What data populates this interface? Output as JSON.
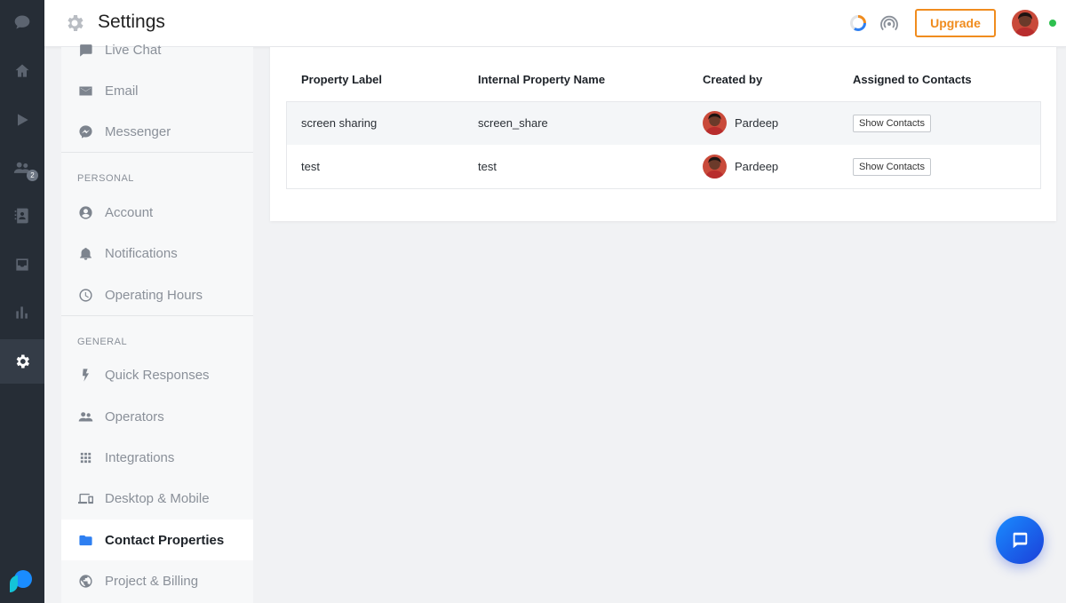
{
  "header": {
    "title": "Settings",
    "upgrade_label": "Upgrade",
    "online_color": "#2ec04f"
  },
  "rail": {
    "items": [
      {
        "name": "chat-icon"
      },
      {
        "name": "home-icon"
      },
      {
        "name": "play-icon"
      },
      {
        "name": "contacts-icon",
        "badge": "2"
      },
      {
        "name": "address-book-icon"
      },
      {
        "name": "inbox-icon"
      },
      {
        "name": "reports-icon"
      },
      {
        "name": "settings-icon",
        "active": true
      }
    ]
  },
  "sidebar": {
    "items": [
      {
        "label": "Live Chat",
        "icon": "chat-bubble-icon"
      },
      {
        "label": "Email",
        "icon": "envelope-icon"
      },
      {
        "label": "Messenger",
        "icon": "messenger-icon"
      },
      {
        "label": "Account",
        "icon": "account-icon"
      },
      {
        "label": "Notifications",
        "icon": "bell-icon"
      },
      {
        "label": "Operating Hours",
        "icon": "clock-icon"
      },
      {
        "label": "Quick Responses",
        "icon": "lightning-icon"
      },
      {
        "label": "Operators",
        "icon": "people-icon"
      },
      {
        "label": "Integrations",
        "icon": "grid-icon"
      },
      {
        "label": "Desktop & Mobile",
        "icon": "devices-icon"
      },
      {
        "label": "Contact Properties",
        "icon": "folder-icon",
        "active": true
      },
      {
        "label": "Project & Billing",
        "icon": "globe-icon"
      }
    ],
    "sections": {
      "personal": "PERSONAL",
      "general": "GENERAL"
    }
  },
  "table": {
    "headers": {
      "label": "Property Label",
      "internal": "Internal Property Name",
      "created_by": "Created by",
      "assigned": "Assigned to Contacts"
    },
    "rows": [
      {
        "label": "screen sharing",
        "internal": "screen_share",
        "created_by": "Pardeep",
        "action": "Show Contacts"
      },
      {
        "label": "test",
        "internal": "test",
        "created_by": "Pardeep",
        "action": "Show Contacts"
      }
    ]
  },
  "colors": {
    "accent": "#2e7ff1",
    "upgrade": "#f08c1e",
    "rail_bg": "#262d36"
  }
}
